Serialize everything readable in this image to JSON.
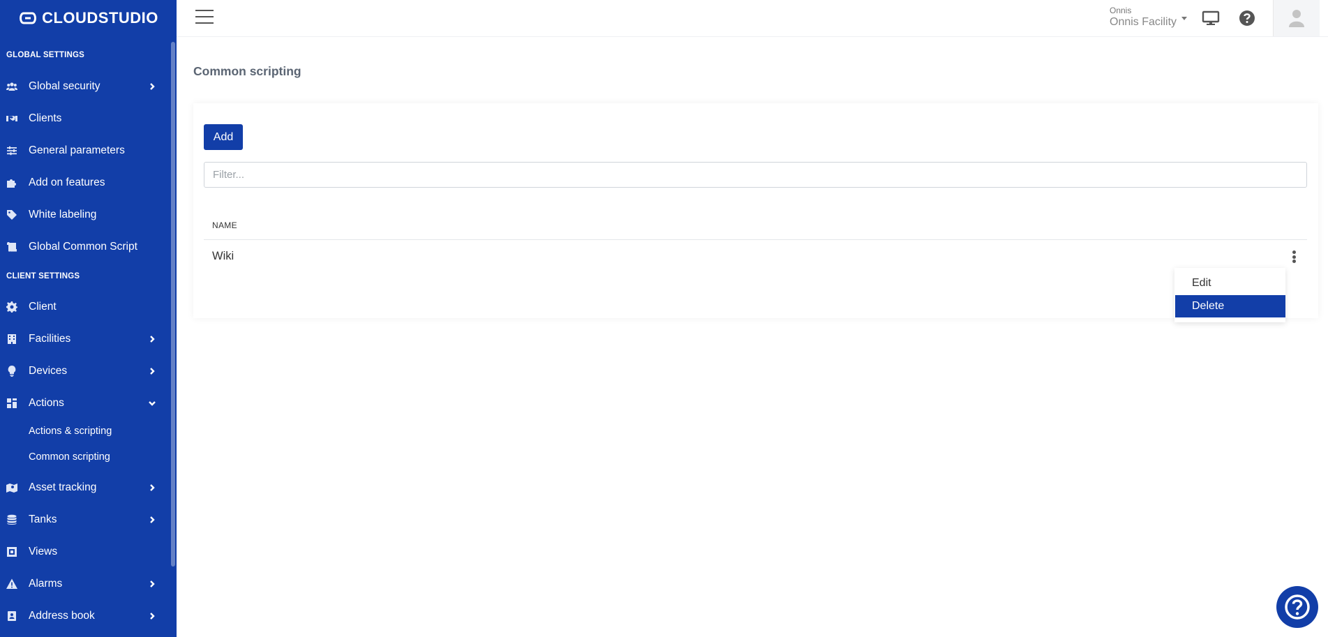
{
  "app": {
    "brand": "CLOUDSTUDIO",
    "colors": {
      "primary": "#123ea8",
      "sidebar_text": "#ffffff",
      "page_title": "#5b6573"
    }
  },
  "sidebar": {
    "sections": [
      {
        "title": "GLOBAL SETTINGS"
      },
      {
        "title": "CLIENT SETTINGS"
      }
    ],
    "items": [
      {
        "label": "Global security",
        "icon": "users-icon",
        "chevron": "right"
      },
      {
        "label": "Clients",
        "icon": "handshake-icon",
        "chevron": "none"
      },
      {
        "label": "General parameters",
        "icon": "sliders-icon",
        "chevron": "none"
      },
      {
        "label": "Add on features",
        "icon": "puzzle-icon",
        "chevron": "none"
      },
      {
        "label": "White labeling",
        "icon": "tag-icon",
        "chevron": "none"
      },
      {
        "label": "Global Common Script",
        "icon": "scroll-icon",
        "chevron": "none"
      },
      {
        "label": "Client",
        "icon": "gear-icon",
        "chevron": "none"
      },
      {
        "label": "Facilities",
        "icon": "building-icon",
        "chevron": "right"
      },
      {
        "label": "Devices",
        "icon": "lightbulb-icon",
        "chevron": "right"
      },
      {
        "label": "Actions",
        "icon": "grid-icon",
        "chevron": "down"
      },
      {
        "label": "Asset tracking",
        "icon": "map-icon",
        "chevron": "right"
      },
      {
        "label": "Tanks",
        "icon": "database-icon",
        "chevron": "right"
      },
      {
        "label": "Views",
        "icon": "frame-icon",
        "chevron": "none"
      },
      {
        "label": "Alarms",
        "icon": "warning-icon",
        "chevron": "right"
      },
      {
        "label": "Address book",
        "icon": "address-book-icon",
        "chevron": "right"
      }
    ],
    "sub_items": [
      {
        "label": "Actions & scripting"
      },
      {
        "label": "Common scripting"
      }
    ]
  },
  "header": {
    "org_small": "Onnis",
    "org_name": "Onnis Facility",
    "icons": [
      "monitor-icon",
      "question-circle-icon",
      "user-avatar-icon"
    ]
  },
  "main": {
    "title": "Common scripting",
    "add_label": "Add",
    "filter_placeholder": "Filter...",
    "table": {
      "columns": [
        "NAME"
      ],
      "rows": [
        {
          "name": "Wiki"
        }
      ]
    },
    "row_menu": {
      "items": [
        "Edit",
        "Delete"
      ],
      "highlighted": "Delete"
    }
  }
}
